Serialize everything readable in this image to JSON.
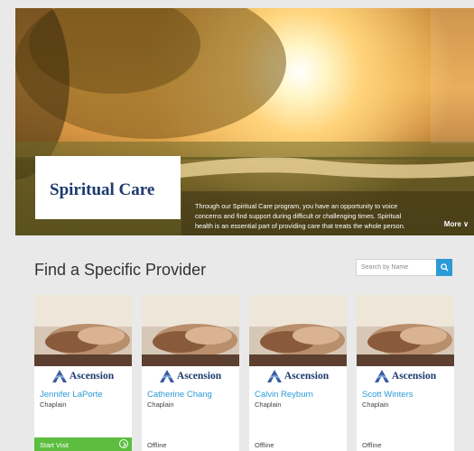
{
  "hero": {
    "title": "Spiritual Care",
    "description": "Through our Spiritual Care program, you have an opportunity to voice concerns and find support during difficult or challenging times. Spiritual health is an essential part of providing care that treats the whole person.",
    "more_label": "More ∨"
  },
  "find": {
    "title": "Find a Specific Provider",
    "search_placeholder": "Search by Name",
    "search_icon": "search-icon"
  },
  "brand": {
    "logo_text": "Ascension",
    "logo_color": "#1d3a6e"
  },
  "colors": {
    "accent": "#2c9ad7",
    "online": "#5cbd3e"
  },
  "providers": [
    {
      "name": "Jennifer LaPorte",
      "role": "Chaplain",
      "status": "Start Visit"
    },
    {
      "name": "Catherine Chang",
      "role": "Chaplain",
      "status": "Offline"
    },
    {
      "name": "Calvin Reyburn",
      "role": "Chaplain",
      "status": "Offline"
    },
    {
      "name": "Scott Winters",
      "role": "Chaplain",
      "status": "Offline"
    }
  ]
}
